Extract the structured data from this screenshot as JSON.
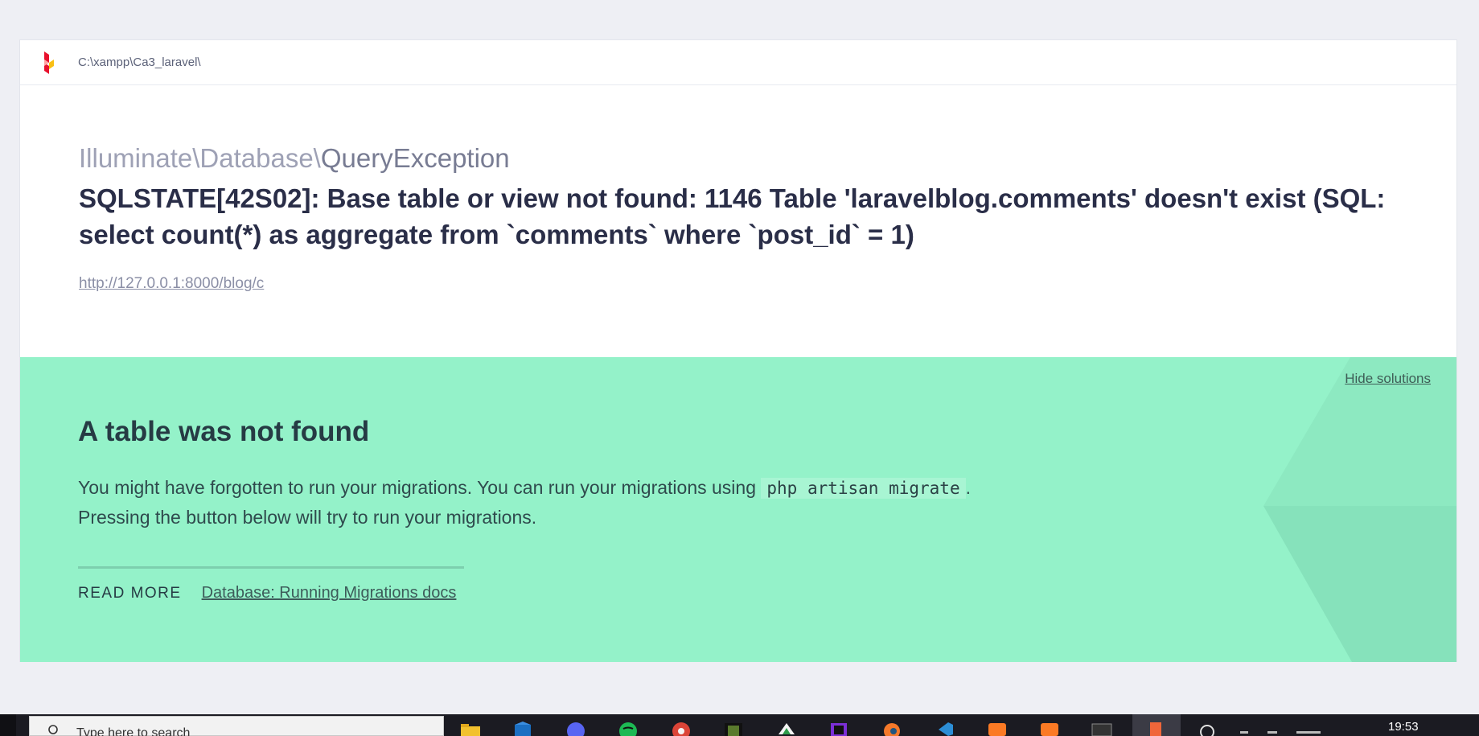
{
  "header": {
    "path": "C:\\xampp\\Ca3_laravel\\",
    "logo": "ignition-logo"
  },
  "exception": {
    "class_prefix": "Illuminate\\Database\\",
    "class_name": "QueryException",
    "message": "SQLSTATE[42S02]: Base table or view not found: 1146 Table 'laravelblog.comments' doesn't exist (SQL: select count(*) as aggregate from `comments` where `post_id` = 1)",
    "url": "http://127.0.0.1:8000/blog/c"
  },
  "solution": {
    "hide_label": "Hide solutions",
    "title": "A table was not found",
    "desc_before": "You might have forgotten to run your migrations. You can run your migrations using ",
    "code": "php artisan migrate",
    "desc_after": ".",
    "desc_line2": "Pressing the button below will try to run your migrations.",
    "read_more_label": "READ MORE",
    "doc_link": "Database: Running Migrations docs",
    "background_color": "#94f2c9"
  },
  "taskbar": {
    "search_placeholder": "Type here to search",
    "clock": "19:53",
    "icons": [
      "file-explorer-icon",
      "mail-icon",
      "discord-icon",
      "spotify-icon",
      "chrome-icon",
      "minecraft-icon",
      "inkscape-icon",
      "phpstorm-icon",
      "blender-icon",
      "vscode-icon",
      "xampp-icon",
      "xampp-icon-2",
      "terminal-icon",
      "ignition-app-icon"
    ]
  }
}
